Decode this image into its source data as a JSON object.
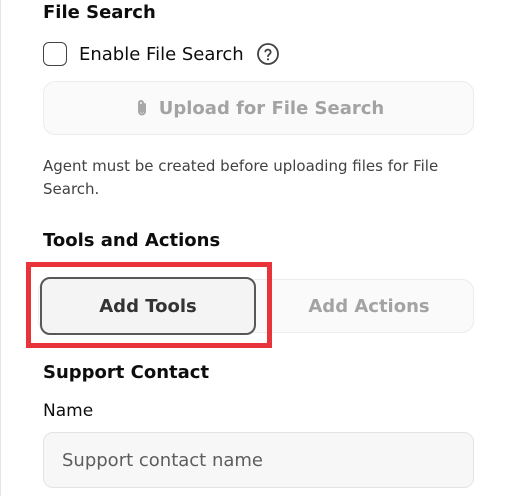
{
  "file_search": {
    "title": "File Search",
    "enable_label": "Enable File Search",
    "enable_checked": false,
    "help_icon": "question-circle-icon",
    "upload_label": "Upload for File Search",
    "upload_icon": "paperclip-icon",
    "helper_text": "Agent must be created before uploading files for File Search."
  },
  "tools_actions": {
    "title": "Tools and Actions",
    "tabs": [
      {
        "label": "Add Tools"
      },
      {
        "label": "Add Actions"
      }
    ],
    "highlight_color": "#e8333a"
  },
  "support_contact": {
    "title": "Support Contact",
    "name_label": "Name",
    "name_placeholder": "Support contact name",
    "name_value": ""
  }
}
